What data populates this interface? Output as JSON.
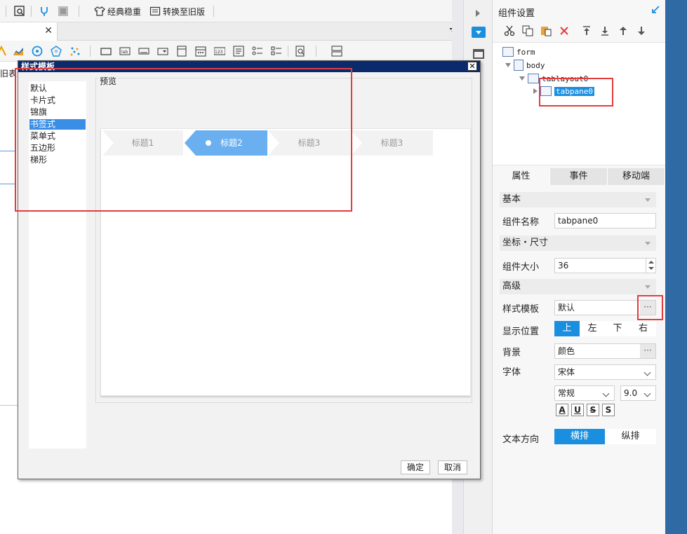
{
  "toolbar": {
    "classic_label": "经典稳重",
    "convert_label": "转换至旧版"
  },
  "canvas": {
    "partial_label": "旧表"
  },
  "dialog": {
    "title": "样式模板",
    "close_glyph": "✕",
    "styles": [
      "默认",
      "卡片式",
      "锦旗",
      "书签式",
      "菜单式",
      "五边形",
      "梯形"
    ],
    "selected_style": "书签式",
    "preview_label": "预览",
    "preview_tabs": [
      "标题1",
      "标题2",
      "标题3",
      "标题3"
    ],
    "active_preview_tab": "标题2",
    "ok_label": "确定",
    "cancel_label": "取消"
  },
  "panel": {
    "title": "组件设置",
    "tree": [
      {
        "label": "form"
      },
      {
        "label": "body"
      },
      {
        "label": "tablayout0"
      },
      {
        "label": "tabpane0"
      }
    ],
    "tabs": [
      "属性",
      "事件",
      "移动端"
    ],
    "sections": {
      "basic": "基本",
      "coords": "坐标・尺寸",
      "advanced": "高级"
    },
    "props": {
      "name_label": "组件名称",
      "name_value": "tabpane0",
      "size_label": "组件大小",
      "size_value": "36",
      "style_label": "样式模板",
      "style_value": "默认",
      "position_label": "显示位置",
      "positions": [
        "上",
        "左",
        "下",
        "右"
      ],
      "bg_label": "背景",
      "bg_value": "颜色",
      "font_label": "字体",
      "font_family": "宋体",
      "font_style": "常规",
      "font_size": "9.0",
      "text_dir_label": "文本方向",
      "text_dirs": [
        "横排",
        "纵排"
      ],
      "dots": "···"
    },
    "format_buttons": [
      "A",
      "U",
      "S",
      "S"
    ]
  },
  "colors": {
    "accent": "#1a8fe0",
    "highlight_red": "#e33c3c",
    "dialog_title_bg": "#0a2a6b"
  }
}
